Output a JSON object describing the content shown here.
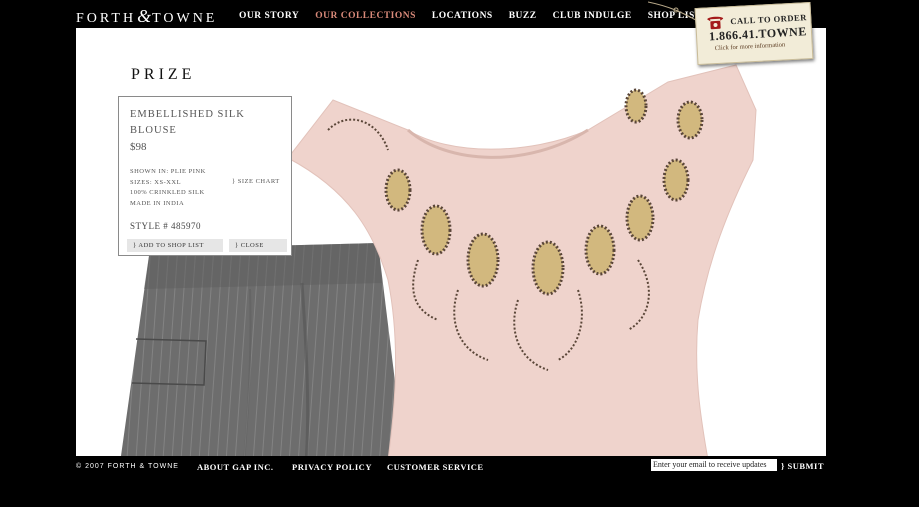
{
  "brand": {
    "name_left": "FORTH",
    "amp": "&",
    "name_right": "TOWNE"
  },
  "nav": [
    {
      "label": "OUR STORY",
      "active": false
    },
    {
      "label": "OUR COLLECTIONS",
      "active": true
    },
    {
      "label": "LOCATIONS",
      "active": false
    },
    {
      "label": "BUZZ",
      "active": false
    },
    {
      "label": "CLUB INDULGE",
      "active": false
    },
    {
      "label": "SHOP LIST",
      "active": false
    }
  ],
  "call_tag": {
    "line1": "CALL TO ORDER",
    "phone": "1.866.41.TOWNE",
    "line3": "Click for more information",
    "icon": "telephone-icon"
  },
  "collection": {
    "title": "PRIZE"
  },
  "product": {
    "name": "EMBELLISHED SILK BLOUSE",
    "price": "$98",
    "shown_in": "SHOWN IN: PLIE PINK",
    "sizes": "SIZES: XS-XXL",
    "material": "100% CRINKLED SILK",
    "origin": "MADE IN INDIA",
    "size_chart": "} SIZE CHART",
    "style": "STYLE # 485970",
    "add_label": "} ADD TO SHOP LIST",
    "close_label": "} CLOSE"
  },
  "footer": {
    "copyright": "© 2007 FORTH & TOWNE",
    "links": [
      "ABOUT GAP INC.",
      "PRIVACY POLICY",
      "CUSTOMER SERVICE"
    ],
    "email_placeholder": "Enter your email to receive updates",
    "submit_label": "} SUBMIT"
  },
  "colors": {
    "accent_active_nav": "#d98a7a",
    "background": "#000000",
    "stage": "#ffffff",
    "tag": "#f2ecd8"
  }
}
